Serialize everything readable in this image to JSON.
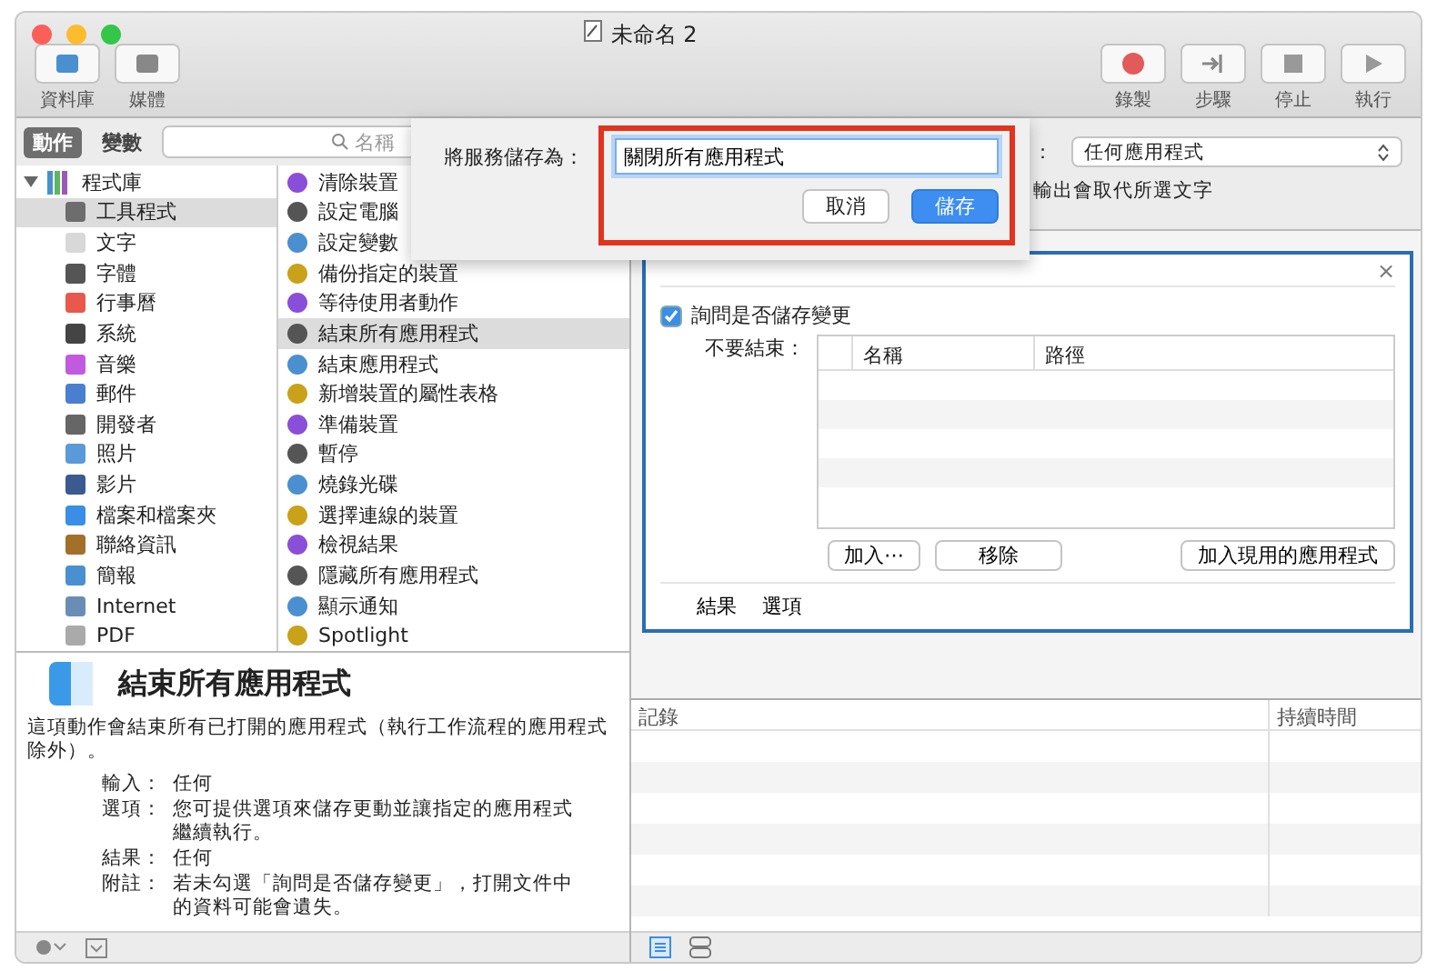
{
  "window": {
    "title": "未命名 2"
  },
  "toolbar": {
    "left": [
      {
        "label": "資料庫"
      },
      {
        "label": "媒體"
      }
    ],
    "right": [
      {
        "label": "錄製",
        "kind": "record"
      },
      {
        "label": "步驟",
        "kind": "step"
      },
      {
        "label": "停止",
        "kind": "stop"
      },
      {
        "label": "執行",
        "kind": "run"
      }
    ]
  },
  "library_tabs": [
    {
      "label": "動作",
      "selected": true
    },
    {
      "label": "變數",
      "selected": false
    }
  ],
  "search": {
    "placeholder": "名稱"
  },
  "categories": {
    "label": "程式庫",
    "expanded": true,
    "children": [
      {
        "label": "工具程式",
        "selected": true
      },
      {
        "label": "文字",
        "selected": false
      },
      {
        "label": "字體",
        "selected": false
      },
      {
        "label": "行事曆",
        "selected": false
      },
      {
        "label": "系統",
        "selected": false
      },
      {
        "label": "音樂",
        "selected": false
      },
      {
        "label": "郵件",
        "selected": false
      },
      {
        "label": "開發者",
        "selected": false
      },
      {
        "label": "照片",
        "selected": false
      },
      {
        "label": "影片",
        "selected": false
      },
      {
        "label": "檔案和檔案夾",
        "selected": false
      },
      {
        "label": "聯絡資訊",
        "selected": false
      },
      {
        "label": "簡報",
        "selected": false
      },
      {
        "label": "Internet",
        "selected": false
      },
      {
        "label": "PDF",
        "selected": false
      }
    ]
  },
  "actions": [
    {
      "label": "清除裝置",
      "selected": false
    },
    {
      "label": "設定電腦",
      "selected": false
    },
    {
      "label": "設定變數",
      "selected": false
    },
    {
      "label": "備份指定的裝置",
      "selected": false
    },
    {
      "label": "等待使用者動作",
      "selected": false
    },
    {
      "label": "結束所有應用程式",
      "selected": true
    },
    {
      "label": "結束應用程式",
      "selected": false
    },
    {
      "label": "新增裝置的屬性表格",
      "selected": false
    },
    {
      "label": "準備裝置",
      "selected": false
    },
    {
      "label": "暫停",
      "selected": false
    },
    {
      "label": "燒錄光碟",
      "selected": false
    },
    {
      "label": "選擇連線的裝置",
      "selected": false
    },
    {
      "label": "檢視結果",
      "selected": false
    },
    {
      "label": "隱藏所有應用程式",
      "selected": false
    },
    {
      "label": "顯示通知",
      "selected": false
    },
    {
      "label": "Spotlight",
      "selected": false
    }
  ],
  "description": {
    "title": "結束所有應用程式",
    "text": "這項動作會結束所有已打開的應用程式（執行工作流程的應用程式除外）。",
    "fields": [
      {
        "label": "輸入：",
        "value": "任何"
      },
      {
        "label": "選項：",
        "value": "您可提供選項來儲存更動並讓指定的應用程式繼續執行。"
      },
      {
        "label": "結果：",
        "value": "任何"
      },
      {
        "label": "附註：",
        "value": "若未勾選「詢問是否儲存變更」，打開文件中的資料可能會遺失。"
      }
    ]
  },
  "workflow_top": {
    "label": "：",
    "dropdown": "任何應用程式",
    "note": "輸出會取代所選文字"
  },
  "action_panel": {
    "close": "×",
    "ask_save": {
      "label": "詢問是否儲存變更",
      "checked": true
    },
    "keep_label": "不要結束：",
    "columns": [
      "名稱",
      "路徑"
    ],
    "buttons": [
      "加入⋯",
      "移除",
      "加入現用的應用程式"
    ],
    "tabs": [
      "結果",
      "選項"
    ]
  },
  "log": {
    "columns": [
      "記錄",
      "持續時間"
    ]
  },
  "sheet": {
    "label": "將服務儲存為：",
    "value": "關閉所有應用程式",
    "buttons": [
      {
        "label": "取消",
        "kind": "cancel"
      },
      {
        "label": "儲存",
        "kind": "default"
      }
    ]
  }
}
